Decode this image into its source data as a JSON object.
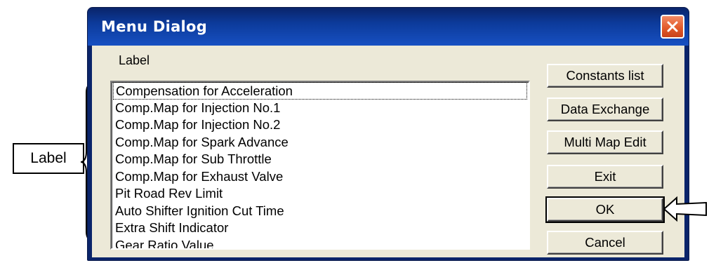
{
  "window": {
    "title": "Menu Dialog",
    "close_icon": "close-icon",
    "accent_title": "#0a246a",
    "close_color": "#e35b2b",
    "client_background": "#ece9d8"
  },
  "caption": {
    "label": "Label"
  },
  "list": {
    "items": [
      "Compensation for Acceleration",
      "Comp.Map for Injection No.1",
      "Comp.Map for Injection No.2",
      "Comp.Map for Spark Advance",
      "Comp.Map for Sub Throttle",
      "Comp.Map for Exhaust Valve",
      "Pit Road Rev Limit",
      "Auto Shifter Ignition Cut Time",
      "Extra Shift Indicator",
      "Gear Ratio Value"
    ],
    "focused_index": 0
  },
  "buttons": {
    "constants_list": "Constants list",
    "data_exchange": "Data Exchange",
    "multi_map_edit": "Multi Map Edit",
    "exit": "Exit",
    "ok": "OK",
    "cancel": "Cancel"
  },
  "annotations": {
    "label_callout": "Label",
    "brace_icon": "left-brace-icon",
    "arrow_icon": "left-arrow-icon"
  }
}
